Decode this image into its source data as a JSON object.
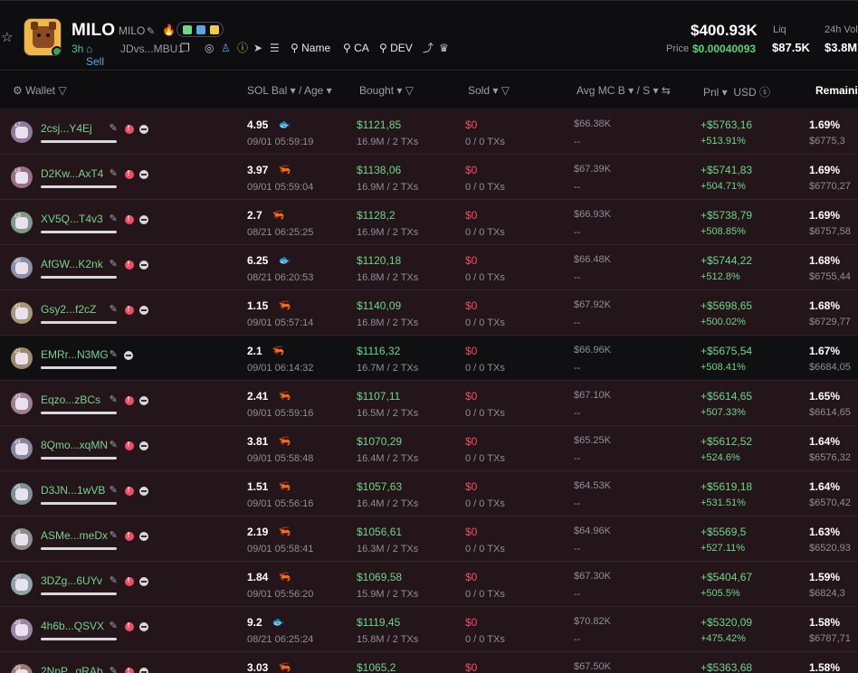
{
  "token": {
    "name": "MILO",
    "symbol": "MILO",
    "age": "3h",
    "sell_label": "Sell",
    "address": "JDvs...MBU1",
    "links": {
      "name": "Name",
      "ca": "CA",
      "dev": "DEV"
    },
    "colors": {
      "accent_green": "#5ed27a",
      "sell_blue": "#5aa7e8",
      "red": "#f04e66"
    }
  },
  "stats": {
    "market_cap": "$400.93K",
    "price_label": "Price",
    "price": "$0.00040093",
    "liq_label": "Liq",
    "liq": "$87.5K",
    "vol_label": "24h Vol",
    "vol": "$3.8M"
  },
  "columns": {
    "wallet": "Wallet",
    "sol_bal": "SOL Bal",
    "age": "/ Age",
    "bought": "Bought",
    "sold": "Sold",
    "avg_mc": "Avg MC B",
    "avg_s": "/ S",
    "pnl": "Pnl",
    "usd": "USD",
    "remaining": "Remaining"
  },
  "rows": [
    {
      "rank": "17",
      "wallet": "2csj...Y4Ej",
      "red": true,
      "sol": "4.95",
      "icon": "fish",
      "time": "09/01 05:59:19",
      "bought": "$1121,85",
      "bought_sub": "16.9M / 2 TXs",
      "sold": "$0",
      "sold_sub": "0 / 0 TXs",
      "avg": "$66.38K",
      "avg_sub": "--",
      "pnl": "+$5763,16",
      "pnl_pct": "+513.91%",
      "rem": "1.69%",
      "rem_sub": "$6775,3"
    },
    {
      "rank": "18",
      "wallet": "D2Kw...AxT4",
      "red": true,
      "sol": "3.97",
      "icon": "shrimp",
      "time": "09/01 05:59:04",
      "bought": "$1138,06",
      "bought_sub": "16.9M / 2 TXs",
      "sold": "$0",
      "sold_sub": "0 / 0 TXs",
      "avg": "$67.39K",
      "avg_sub": "--",
      "pnl": "+$5741,83",
      "pnl_pct": "+504.71%",
      "rem": "1.69%",
      "rem_sub": "$6770,27"
    },
    {
      "rank": "19",
      "wallet": "XV5Q...T4v3",
      "red": true,
      "sol": "2.7",
      "icon": "shrimp",
      "time": "08/21 06:25:25",
      "bought": "$1128,2",
      "bought_sub": "16.9M / 2 TXs",
      "sold": "$0",
      "sold_sub": "0 / 0 TXs",
      "avg": "$66.93K",
      "avg_sub": "--",
      "pnl": "+$5738,79",
      "pnl_pct": "+508.85%",
      "rem": "1.69%",
      "rem_sub": "$6757,58"
    },
    {
      "rank": "20",
      "wallet": "AfGW...K2nk",
      "red": true,
      "sol": "6.25",
      "icon": "fish",
      "time": "08/21 06:20:53",
      "bought": "$1120,18",
      "bought_sub": "16.8M / 2 TXs",
      "sold": "$0",
      "sold_sub": "0 / 0 TXs",
      "avg": "$66.48K",
      "avg_sub": "--",
      "pnl": "+$5744,22",
      "pnl_pct": "+512.8%",
      "rem": "1.68%",
      "rem_sub": "$6755,44"
    },
    {
      "rank": "21",
      "wallet": "Gsy2...f2cZ",
      "red": true,
      "sol": "1.15",
      "icon": "shrimp",
      "time": "09/01 05:57:14",
      "bought": "$1140,09",
      "bought_sub": "16.8M / 2 TXs",
      "sold": "$0",
      "sold_sub": "0 / 0 TXs",
      "avg": "$67.92K",
      "avg_sub": "--",
      "pnl": "+$5698,65",
      "pnl_pct": "+500.02%",
      "rem": "1.68%",
      "rem_sub": "$6729,77"
    },
    {
      "rank": "22",
      "wallet": "EMRr...N3MG",
      "red": false,
      "sol": "2.1",
      "icon": "shrimp",
      "time": "09/01 06:14:32",
      "bought": "$1116,32",
      "bought_sub": "16.7M / 2 TXs",
      "sold": "$0",
      "sold_sub": "0 / 0 TXs",
      "avg": "$66.96K",
      "avg_sub": "--",
      "pnl": "+$5675,54",
      "pnl_pct": "+508.41%",
      "rem": "1.67%",
      "rem_sub": "$6684,05"
    },
    {
      "rank": "23",
      "wallet": "Eqzo...zBCs",
      "red": true,
      "sol": "2.41",
      "icon": "shrimp",
      "time": "09/01 05:59:16",
      "bought": "$1107,11",
      "bought_sub": "16.5M / 2 TXs",
      "sold": "$0",
      "sold_sub": "0 / 0 TXs",
      "avg": "$67.10K",
      "avg_sub": "--",
      "pnl": "+$5614,65",
      "pnl_pct": "+507.33%",
      "rem": "1.65%",
      "rem_sub": "$6614,65"
    },
    {
      "rank": "24",
      "wallet": "8Qmo...xqMN",
      "red": true,
      "sol": "3.81",
      "icon": "shrimp",
      "time": "09/01 05:58:48",
      "bought": "$1070,29",
      "bought_sub": "16.4M / 2 TXs",
      "sold": "$0",
      "sold_sub": "0 / 0 TXs",
      "avg": "$65.25K",
      "avg_sub": "--",
      "pnl": "+$5612,52",
      "pnl_pct": "+524.6%",
      "rem": "1.64%",
      "rem_sub": "$6576,32"
    },
    {
      "rank": "25",
      "wallet": "D3JN...1wVB",
      "red": true,
      "sol": "1.51",
      "icon": "shrimp",
      "time": "09/01 05:56:16",
      "bought": "$1057,63",
      "bought_sub": "16.4M / 2 TXs",
      "sold": "$0",
      "sold_sub": "0 / 0 TXs",
      "avg": "$64.53K",
      "avg_sub": "--",
      "pnl": "+$5619,18",
      "pnl_pct": "+531.51%",
      "rem": "1.64%",
      "rem_sub": "$6570,42"
    },
    {
      "rank": "26",
      "wallet": "ASMe...meDx",
      "red": true,
      "sol": "2.19",
      "icon": "shrimp",
      "time": "09/01 05:58:41",
      "bought": "$1056,61",
      "bought_sub": "16.3M / 2 TXs",
      "sold": "$0",
      "sold_sub": "0 / 0 TXs",
      "avg": "$64.96K",
      "avg_sub": "--",
      "pnl": "+$5569,5",
      "pnl_pct": "+527.11%",
      "rem": "1.63%",
      "rem_sub": "$6520,93"
    },
    {
      "rank": "27",
      "wallet": "3DZg...6UYv",
      "red": true,
      "sol": "1.84",
      "icon": "shrimp",
      "time": "09/01 05:56:20",
      "bought": "$1069,58",
      "bought_sub": "15.9M / 2 TXs",
      "sold": "$0",
      "sold_sub": "0 / 0 TXs",
      "avg": "$67.30K",
      "avg_sub": "--",
      "pnl": "+$5404,67",
      "pnl_pct": "+505.5%",
      "rem": "1.59%",
      "rem_sub": "$6824,3"
    },
    {
      "rank": "28",
      "wallet": "4h6b...QSVX",
      "red": true,
      "sol": "9.2",
      "icon": "fish",
      "time": "08/21 06:25:24",
      "bought": "$1119,45",
      "bought_sub": "15.8M / 2 TXs",
      "sold": "$0",
      "sold_sub": "0 / 0 TXs",
      "avg": "$70.82K",
      "avg_sub": "--",
      "pnl": "+$5320,09",
      "pnl_pct": "+475.42%",
      "rem": "1.58%",
      "rem_sub": "$6787,71"
    },
    {
      "rank": "29",
      "wallet": "2NpP...gRAb",
      "red": true,
      "sol": "3.03",
      "icon": "shrimp",
      "time": "",
      "bought": "$1065,2",
      "bought_sub": "",
      "sold": "$0",
      "sold_sub": "",
      "avg": "$67.50K",
      "avg_sub": "",
      "pnl": "+$5363,68",
      "pnl_pct": "",
      "rem": "1.58%",
      "rem_sub": ""
    }
  ]
}
